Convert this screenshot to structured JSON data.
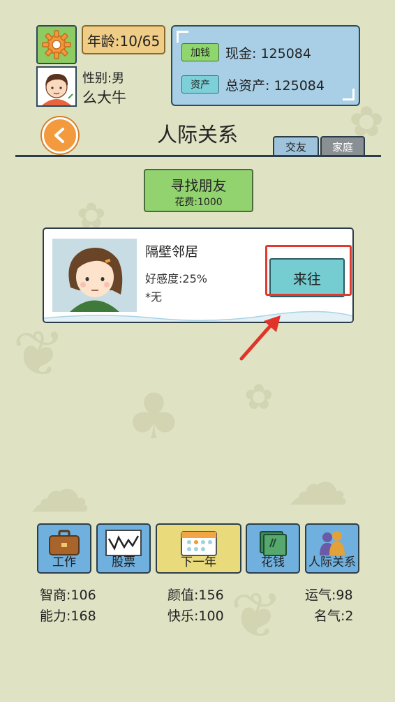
{
  "header": {
    "age_label": "年龄:10/65",
    "gender_label": "性别:男",
    "player_name": "么大牛"
  },
  "money": {
    "add_cash_label": "加钱",
    "cash_label": "现金: 125084",
    "assets_button_label": "资产",
    "total_assets_label": "总资产: 125084"
  },
  "page": {
    "title": "人际关系",
    "tabs": [
      {
        "label": "交友",
        "active": true
      },
      {
        "label": "家庭",
        "active": false
      }
    ]
  },
  "find_friend": {
    "label": "寻找朋友",
    "cost": "花费:1000"
  },
  "friend_card": {
    "name": "隔壁邻居",
    "affinity": "好感度:25%",
    "note": "*无",
    "visit_label": "来往"
  },
  "bottom_nav": [
    {
      "label": "工作",
      "icon": "briefcase-icon"
    },
    {
      "label": "股票",
      "icon": "stock-chart-icon"
    },
    {
      "label": "下一年",
      "icon": "calendar-icon"
    },
    {
      "label": "花钱",
      "icon": "cash-stack-icon"
    },
    {
      "label": "人际关系",
      "icon": "people-icon"
    }
  ],
  "stats": {
    "iq": "智商:106",
    "looks": "颜值:156",
    "luck": "运气:98",
    "ability": "能力:168",
    "happiness": "快乐:100",
    "fame": "名气:2"
  },
  "colors": {
    "background": "#dfe3c4",
    "green_button": "#92d36f",
    "blue_panel": "#a8cfe6",
    "orange": "#f39a3e",
    "highlight_red": "#e03a2f"
  }
}
